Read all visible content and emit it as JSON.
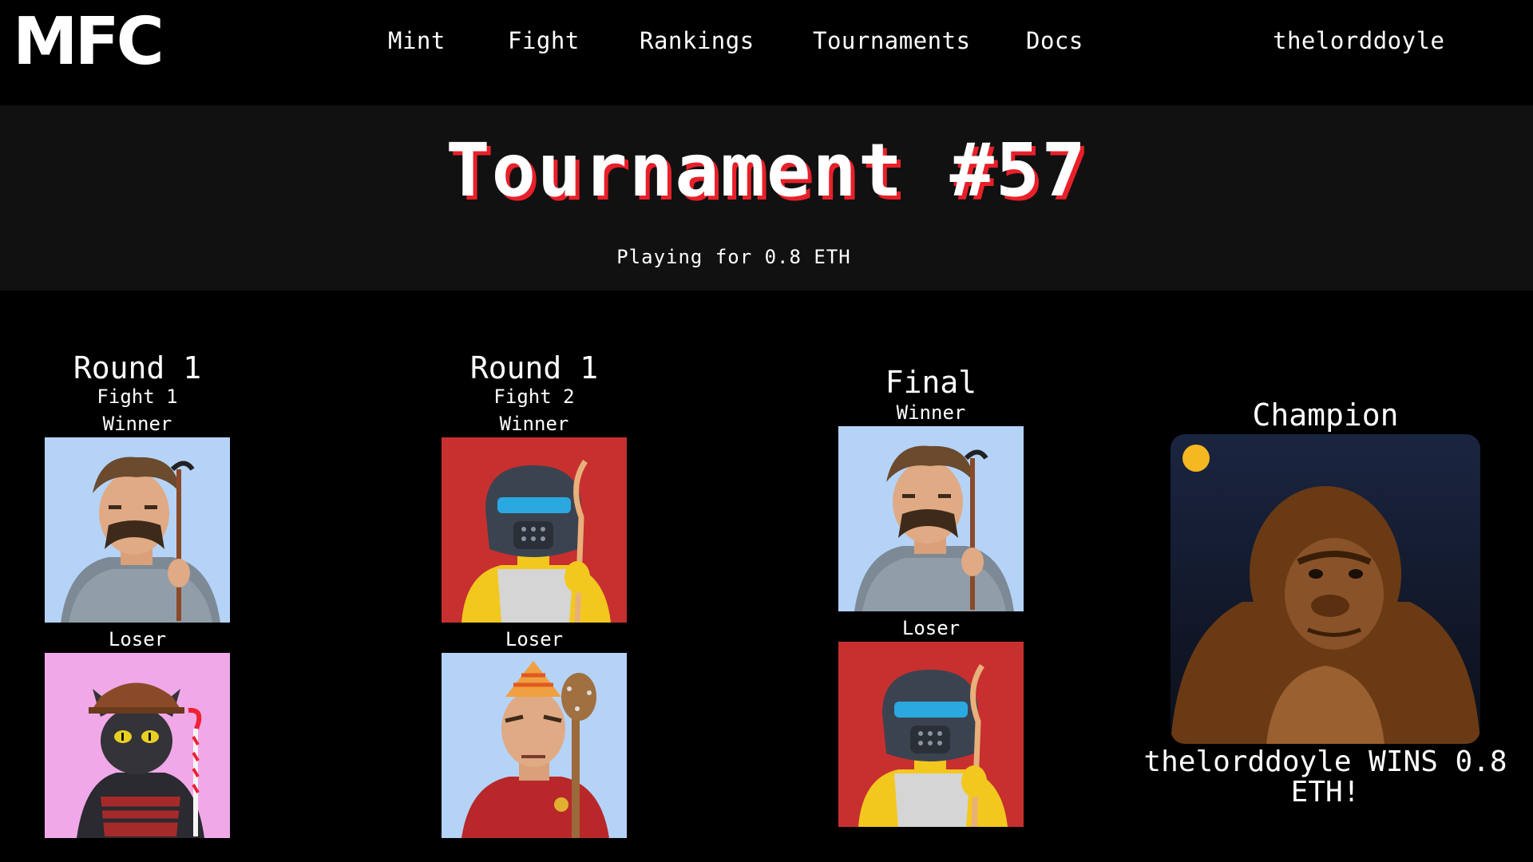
{
  "header": {
    "logo": "MFC",
    "nav": [
      "Mint",
      "Fight",
      "Rankings",
      "Tournaments",
      "Docs"
    ],
    "user": "thelorddoyle"
  },
  "tournament": {
    "title": "Tournament #57",
    "prize": "Playing for 0.8 ETH"
  },
  "bracket": [
    {
      "round": "Round 1",
      "fight": "Fight 1",
      "winner_label": "Winner",
      "loser_label": "Loser",
      "winner_fighter": "bearded-fighter-icon",
      "loser_fighter": "cat-fighter-icon"
    },
    {
      "round": "Round 1",
      "fight": "Fight 2",
      "winner_label": "Winner",
      "loser_label": "Loser",
      "winner_fighter": "robot-fighter-icon",
      "loser_fighter": "roman-fighter-icon"
    },
    {
      "round": "Final",
      "winner_label": "Winner",
      "loser_label": "Loser",
      "winner_fighter": "bearded-fighter-icon",
      "loser_fighter": "robot-fighter-icon"
    }
  ],
  "champion": {
    "title": "Champion",
    "avatar": "gorilla-fighter-icon",
    "message": "thelorddoyle WINS 0.8 ETH!"
  },
  "colors": {
    "title_shadow": "#e8202a",
    "card_blue": "#b5d3f7",
    "card_red": "#c7302f",
    "card_pink": "#f0a8e8",
    "banner_bg": "#111111"
  }
}
